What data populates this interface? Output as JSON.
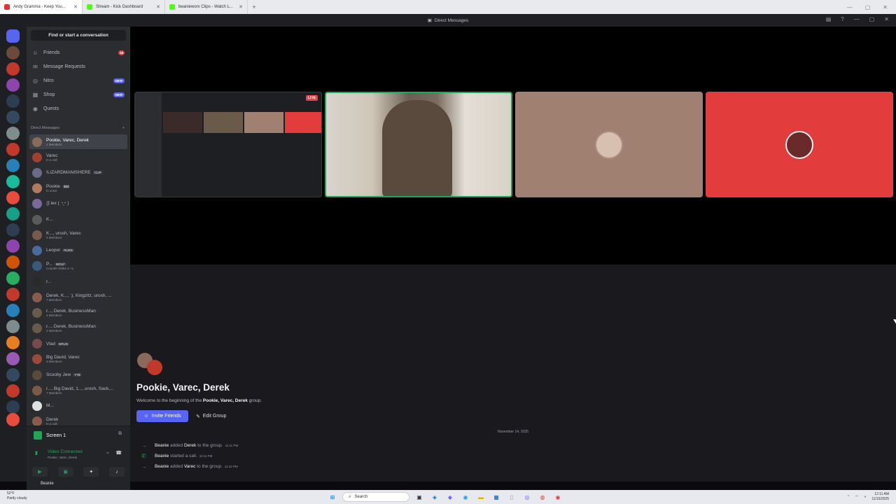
{
  "browser": {
    "tabs": [
      {
        "title": "Andy Gramma - Keep You...",
        "favicon_color": "#e5322d",
        "active": true
      },
      {
        "title": "Stream - Kick Dashboard",
        "favicon_color": "#53fc18",
        "active": false
      },
      {
        "title": "beanieworx Clips - Watch L...",
        "favicon_color": "#53fc18",
        "active": false
      }
    ],
    "new_tab": "+"
  },
  "titlebar": {
    "title": "Direct Messages"
  },
  "sidebar": {
    "search_button": "Find or start a conversation",
    "nav": [
      {
        "label": "Friends",
        "icon": "friends-icon",
        "badge": "18"
      },
      {
        "label": "Message Requests",
        "icon": "mail-icon",
        "badge": ""
      },
      {
        "label": "Nitro",
        "icon": "nitro-icon",
        "badge": "NEW"
      },
      {
        "label": "Shop",
        "icon": "shop-icon",
        "badge": "NEW"
      },
      {
        "label": "Quests",
        "icon": "quests-icon",
        "badge": ""
      }
    ],
    "dm_header": "Direct Messages",
    "dm_add": "+",
    "dms": [
      {
        "name": "Pookie, Varec, Derek",
        "sub": "4 Members",
        "tag": "",
        "color": "#8a6a5a",
        "active": true
      },
      {
        "name": "Varec",
        "sub": "In a call",
        "tag": "",
        "color": "#a04030",
        "active": false
      },
      {
        "name": "!LIZARDMANISHERE",
        "sub": "",
        "tag": "CLIP",
        "color": "#6a6a8a",
        "active": false
      },
      {
        "name": "Pookie",
        "sub": "In voice",
        "tag": "$$$",
        "color": "#b07a60",
        "active": false
      },
      {
        "name": "ශ්‍රී lex ( ◔̯◔ )",
        "sub": "",
        "tag": "",
        "color": "#7a6a9a",
        "active": false
      },
      {
        "name": "K...",
        "sub": "",
        "tag": "",
        "color": "#5a5a5a",
        "active": false
      },
      {
        "name": "K..., urosh, Varec",
        "sub": "4 Members",
        "tag": "",
        "color": "#7a5a4a",
        "active": false
      },
      {
        "name": "Leoper",
        "sub": "",
        "tag": "RUSS",
        "color": "#4a6a9a",
        "active": false
      },
      {
        "name": "P...",
        "sub": "Counter-Strike 2 +1",
        "tag": "WOLF",
        "color": "#3a5a7a",
        "active": false
      },
      {
        "name": "r...",
        "sub": "",
        "tag": "",
        "color": "#2a2a2a",
        "active": false
      },
      {
        "name": "Derek, K..., :), Kingzitz, urosh, ...",
        "sub": "7 Members",
        "tag": "",
        "color": "#8a5a4a",
        "active": false
      },
      {
        "name": "r..., Derek, BusinessMan",
        "sub": "4 Members",
        "tag": "",
        "color": "#6a5a4a",
        "active": false
      },
      {
        "name": "r..., Derek, BusinessMan",
        "sub": "4 Members",
        "tag": "",
        "color": "#6a5a4a",
        "active": false
      },
      {
        "name": "Vlad",
        "sub": "",
        "tag": "DRUG",
        "color": "#7a4a4a",
        "active": false
      },
      {
        "name": "Big David, Varec",
        "sub": "3 Members",
        "tag": "",
        "color": "#9a4a3a",
        "active": false
      },
      {
        "name": "Scooby Jew",
        "sub": "",
        "tag": "YTB",
        "color": "#5a4a3a",
        "active": false
      },
      {
        "name": "r..., Big David, 1..., urosh, Sack,...",
        "sub": "7 Members",
        "tag": "",
        "color": "#7a5a4a",
        "active": false
      },
      {
        "name": "M...",
        "sub": "",
        "tag": "",
        "color": "#e0e0e0",
        "active": false
      },
      {
        "name": "Derek",
        "sub": "In a call",
        "tag": "",
        "color": "#8a5a4a",
        "active": false
      }
    ],
    "voice": {
      "screen_label": "Screen 1",
      "status": "Video Connected",
      "channel": "Pookie, Varec, Derek"
    },
    "user": "Beanie"
  },
  "call": {
    "live_badge": "LIVE",
    "tiles": [
      {
        "kind": "screenshare",
        "bg": "#1e1f22"
      },
      {
        "kind": "camera",
        "bg": "#8a7a6a",
        "speaking": true
      },
      {
        "kind": "avatar",
        "bg": "#a08070"
      },
      {
        "kind": "avatar",
        "bg": "#e23c3c"
      }
    ]
  },
  "chat": {
    "group_title": "Pookie, Varec, Derek",
    "welcome_prefix": "Welcome to the beginning of the ",
    "welcome_group": "Pookie, Varec, Derek",
    "welcome_suffix": " group.",
    "invite_button": "Invite Friends",
    "edit_button": "Edit Group",
    "date_divider": "November 14, 2025",
    "messages": [
      {
        "actor": "Beanie",
        "action": " added ",
        "target": "Derek",
        "rest": " to the group.",
        "time": "11:11 PM",
        "icon": "arrow-right-icon"
      },
      {
        "actor": "Beanie",
        "action": " started a call.",
        "target": "",
        "rest": "",
        "time": "11:11 PM",
        "icon": "phone-icon"
      },
      {
        "actor": "Beanie",
        "action": " added ",
        "target": "Varec",
        "rest": " to the group.",
        "time": "11:42 PM",
        "icon": "arrow-right-icon"
      }
    ]
  },
  "taskbar": {
    "weather_temp": "52°F",
    "weather_desc": "Partly cloudy",
    "search": "Search",
    "time": "12:11 AM",
    "date": "11/15/2025"
  }
}
